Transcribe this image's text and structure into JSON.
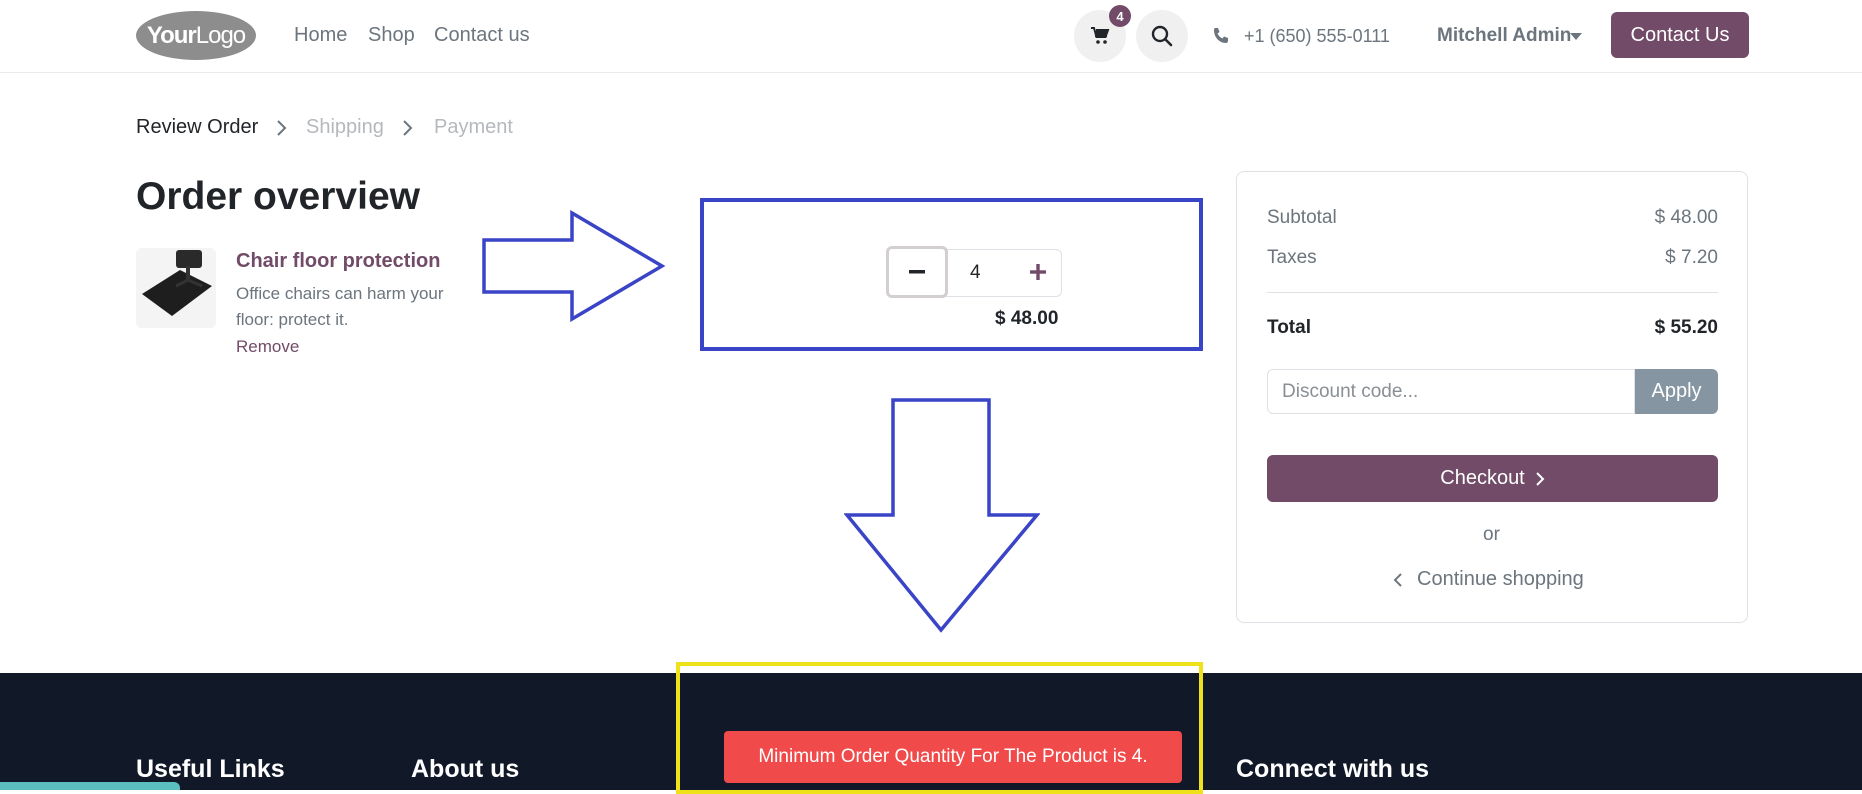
{
  "header": {
    "logo_text_bold": "Your",
    "logo_text": "Logo",
    "nav": [
      "Home",
      "Shop",
      "Contact us"
    ],
    "cart_count": "4",
    "phone": "+1 (650) 555-0111",
    "user": "Mitchell Admin",
    "contact_button": "Contact Us"
  },
  "breadcrumb": {
    "steps": [
      "Review Order",
      "Shipping",
      "Payment"
    ]
  },
  "page": {
    "title": "Order overview"
  },
  "cart_line": {
    "name": "Chair floor protection",
    "description": "Office chairs can harm your floor: protect it.",
    "remove_label": "Remove",
    "quantity": "4",
    "price": "$ 48.00"
  },
  "summary": {
    "subtotal_label": "Subtotal",
    "subtotal_value": "$ 48.00",
    "taxes_label": "Taxes",
    "taxes_value": "$ 7.20",
    "total_label": "Total",
    "total_value": "$ 55.20",
    "discount_placeholder": "Discount code...",
    "apply_label": "Apply",
    "checkout_label": "Checkout",
    "or_label": "or",
    "continue_label": "Continue shopping"
  },
  "footer": {
    "headings": [
      "Useful Links",
      "About us",
      "Connect with us"
    ]
  },
  "toast": {
    "message": "Minimum Order Quantity For The Product is 4."
  },
  "colors": {
    "brand": "#714b67",
    "annotation_blue": "#3a44c7",
    "annotation_yellow": "#f0e21a",
    "toast_red": "#f04a4a",
    "footer_bg": "#111827"
  }
}
